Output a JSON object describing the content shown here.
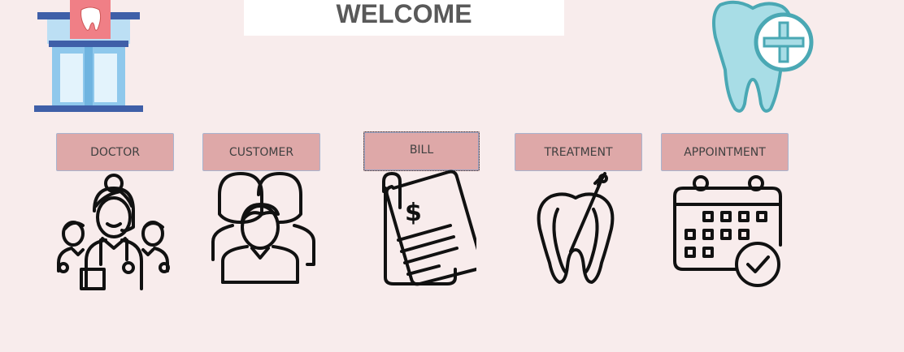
{
  "header": {
    "title": "WELCOME"
  },
  "nav": {
    "doctor_label": "DOCTOR",
    "customer_label": "CUSTOMER",
    "bill_label": "BILL",
    "treatment_label": "TREATMENT",
    "appointment_label": "APPOINTMENT"
  },
  "icons": {
    "clinic": "dental-clinic-building-icon",
    "tooth_plus": "tooth-plus-icon",
    "doctor": "doctors-group-icon",
    "customer": "customers-group-icon",
    "bill": "bill-document-icon",
    "treatment": "tooth-root-canal-icon",
    "appointment": "calendar-check-icon"
  },
  "colors": {
    "background": "#f8ecec",
    "button": "#dea8a8",
    "title_text": "#595959",
    "tooth_fill": "#a8dde6",
    "tooth_stroke": "#4aa8b4"
  }
}
